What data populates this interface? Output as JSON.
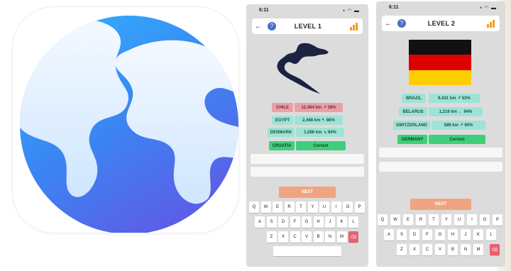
{
  "screen1": {
    "time": "6:11",
    "level_title": "LEVEL 1",
    "guesses": [
      {
        "country": "CHILE",
        "info": "12,484 km ↗ 38%",
        "status": "red"
      },
      {
        "country": "EGYPT",
        "info": "2,468 km ↖ 86%",
        "status": "teal"
      },
      {
        "country": "DENMARK",
        "info": "1,086 km ↘ 94%",
        "status": "teal"
      },
      {
        "country": "CROATIA",
        "info": "Correct",
        "status": "green"
      }
    ],
    "next_label": "NEXT",
    "keyboard_rows": [
      [
        "Q",
        "W",
        "E",
        "R",
        "T",
        "Y",
        "U",
        "I",
        "O",
        "P"
      ],
      [
        "A",
        "S",
        "D",
        "F",
        "G",
        "H",
        "J",
        "K",
        "L"
      ],
      [
        "Z",
        "X",
        "C",
        "V",
        "B",
        "N",
        "M"
      ]
    ]
  },
  "screen2": {
    "time": "6:11",
    "level_title": "LEVEL 2",
    "guesses": [
      {
        "country": "BRAZIL",
        "info": "9,431 km ↗ 53%",
        "status": "teal"
      },
      {
        "country": "BELARUS",
        "info": "1,216 km ← 94%",
        "status": "teal"
      },
      {
        "country": "SWITZERLAND",
        "info": "589 km ↗ 90%",
        "status": "teal"
      },
      {
        "country": "GERMANY",
        "info": "Correct",
        "status": "green"
      }
    ],
    "next_label": "NEXT",
    "keyboard_rows": [
      [
        "Q",
        "W",
        "E",
        "R",
        "T",
        "Y",
        "U",
        "I",
        "O",
        "P"
      ],
      [
        "A",
        "S",
        "D",
        "F",
        "G",
        "H",
        "J",
        "K",
        "L"
      ],
      [
        "Z",
        "X",
        "C",
        "V",
        "B",
        "N",
        "M"
      ]
    ]
  },
  "colors": {
    "teal": "#9fe3d6",
    "red": "#e8a0a6",
    "green": "#3fcf7a",
    "next": "#f0a480",
    "help": "#4a6fc9",
    "flag_black": "#111111",
    "flag_red": "#dd0000",
    "flag_gold": "#ffce00"
  },
  "icons": {
    "app": "globe-icon",
    "back": "back-arrow-icon",
    "help": "help-icon",
    "stats": "stats-icon",
    "delete": "delete-icon"
  }
}
